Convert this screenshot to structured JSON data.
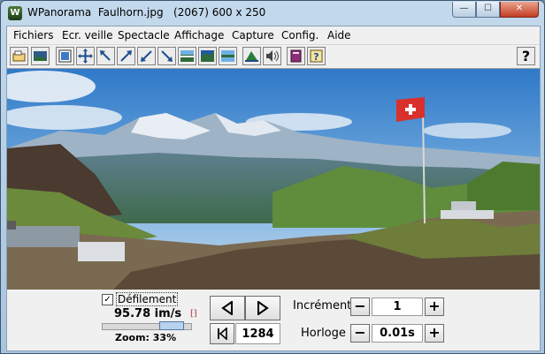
{
  "window": {
    "title": "WPanorama  Faulhorn.jpg   (2067) 600 x 250",
    "app_icon": "wpanorama-app-icon",
    "buttons": {
      "minimize": "—",
      "maximize": "☐",
      "close": "✕"
    }
  },
  "menu": [
    {
      "label": "Fichiers"
    },
    {
      "label": "Ecr. veille"
    },
    {
      "label": "Spectacle"
    },
    {
      "label": "Affichage"
    },
    {
      "label": "Capture"
    },
    {
      "label": "Config."
    },
    {
      "label": "Aide"
    }
  ],
  "toolbar": {
    "buttons": [
      "open-icon",
      "picture-icon",
      "fit-window-icon",
      "expand-all-icon",
      "shrink-icon",
      "arrow-upright-icon",
      "arrow-downleft-icon",
      "arrow-downright-icon",
      "panorama-top-icon",
      "panorama-mid-icon",
      "panorama-bottom-icon",
      "landscape-icon",
      "sound-icon",
      "book-icon",
      "help-book-icon"
    ],
    "help_label": "?"
  },
  "panorama": {
    "description_icon": "panorama-image",
    "flag_color": "#d9302b"
  },
  "controls": {
    "scroll_checked": true,
    "scroll_check_mark": "✓",
    "scroll_label": "Défilement",
    "speed": "95.78 im/s",
    "zoom": "Zoom: 33%",
    "zoom_percent": 33,
    "frame": "1284",
    "increment_label": "Incrément",
    "increment_value": "1",
    "clock_label": "Horloge",
    "clock_value": "0.01s",
    "minus": "−",
    "plus": "+"
  }
}
